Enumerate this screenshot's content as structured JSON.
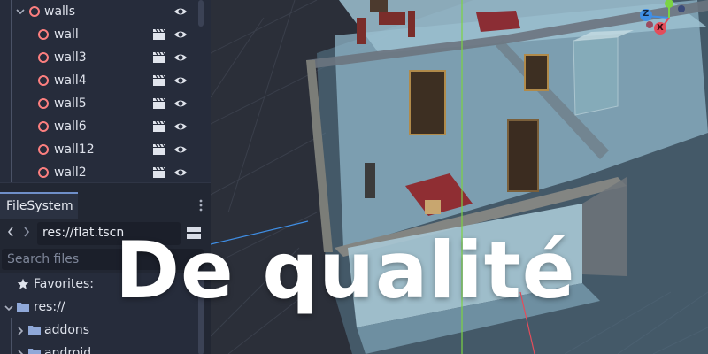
{
  "scene_tree": {
    "group": {
      "label": "walls",
      "icon": "node3d-icon"
    },
    "items": [
      {
        "label": "wall"
      },
      {
        "label": "wall3"
      },
      {
        "label": "wall4"
      },
      {
        "label": "wall5"
      },
      {
        "label": "wall6"
      },
      {
        "label": "wall12"
      },
      {
        "label": "wall2"
      }
    ],
    "row_icons": [
      "clapperboard-icon",
      "eye-icon"
    ]
  },
  "filesystem": {
    "tab_label": "FileSystem",
    "path": "res://flat.tscn",
    "search_placeholder": "Search files",
    "favorites_label": "Favorites:",
    "root_label": "res://",
    "folders": [
      {
        "label": "addons"
      },
      {
        "label": "android"
      }
    ]
  },
  "viewport": {
    "gizmo": {
      "z_label": "Z",
      "x_label": "X"
    }
  },
  "overlay": {
    "headline": "De qualité"
  },
  "colors": {
    "node_icon": "#fc7f7f",
    "accent": "#6f8fc9",
    "gizmo_z": "#3f8fe6",
    "gizmo_x": "#e34d5b",
    "gizmo_y": "#7bd443",
    "floor": "#8fb5c8"
  }
}
